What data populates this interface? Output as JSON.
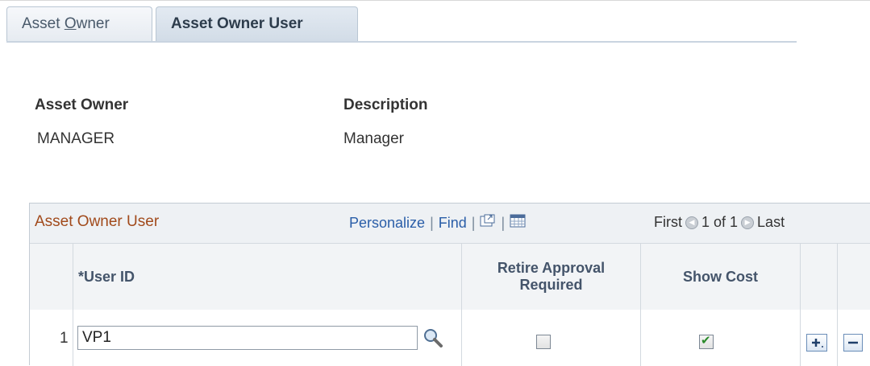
{
  "tabs": {
    "owner": "Asset Owner",
    "owner_user": "Asset Owner User"
  },
  "header": {
    "owner_label": "Asset Owner",
    "owner_value": "MANAGER",
    "desc_label": "Description",
    "desc_value": "Manager"
  },
  "grid": {
    "title": "Asset Owner User",
    "personalize": "Personalize",
    "find": "Find",
    "separator": "|",
    "first": "First",
    "count": "1 of 1",
    "last": "Last",
    "columns": {
      "user_id": "*User ID",
      "retire": "Retire Approval Required",
      "show_cost": "Show Cost"
    },
    "rows": [
      {
        "num": "1",
        "user_id": "VP1",
        "retire_checked": false,
        "show_cost_checked": true
      }
    ]
  },
  "colors": {
    "title": "#a14a1b",
    "link": "#2a5ea8"
  }
}
